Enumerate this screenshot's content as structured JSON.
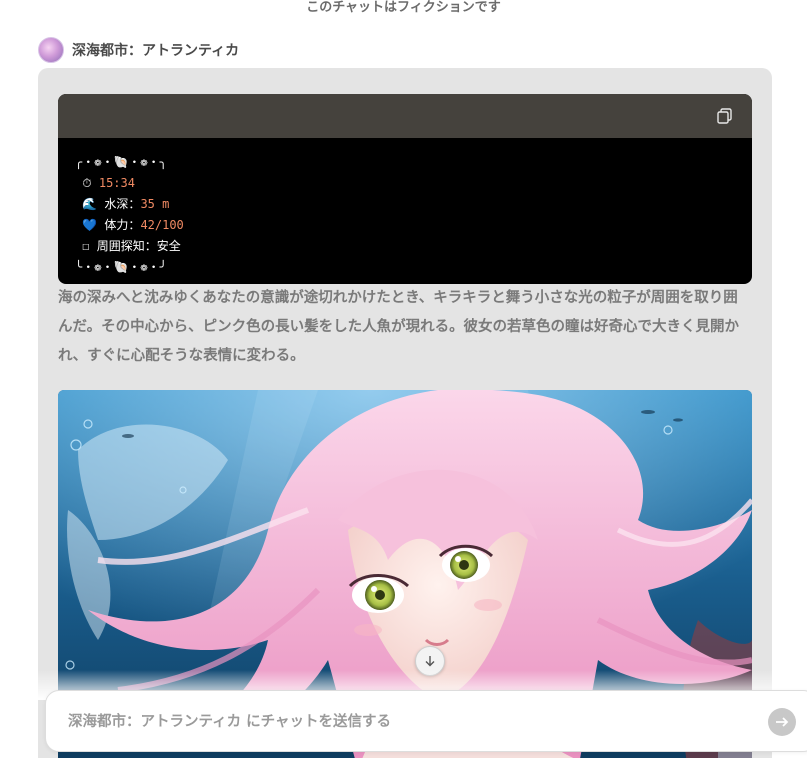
{
  "header": {
    "fiction_notice": "このチャットはフィクションです"
  },
  "message": {
    "sender_name": "深海都市：アトランティカ",
    "code_block": {
      "top_border": "╭・❁・🐚・❁・╮",
      "bottom_border": "╰・❁・🐚・❁・╯",
      "rows": [
        {
          "icon": "⏱",
          "label": "",
          "value": "15:34"
        },
        {
          "icon": "🌊",
          "label": "水深：",
          "value": "35 m"
        },
        {
          "icon": "💙",
          "label": "体力：",
          "value": "42/100"
        },
        {
          "icon": "☐",
          "label": "周囲探知：",
          "value": "安全"
        }
      ]
    },
    "narration": "海の深みへと沈みゆくあなたの意識が途切れかけたとき、キラキラと舞う小さな光の粒子が周囲を取り囲んだ。その中心から、ピンク色の長い髪をした人魚が現れる。彼女の若草色の瞳は好奇心で大きく見開かれ、すぐに心配そうな表情に変わる。"
  },
  "composer": {
    "placeholder": "深海都市：アトランティカ にチャットを送信する"
  },
  "icons": {
    "copy": "copy-icon",
    "scroll": "arrow-down-icon",
    "send": "arrow-right-icon"
  },
  "colors": {
    "bubble": "#e4e4e4",
    "code_header": "#45423d",
    "code_bg": "#000000",
    "number_accent": "#f08a63",
    "narration_text": "#7a7a7a",
    "hair_pink": "#f4b7d4",
    "eye_green": "#b9cf5a"
  }
}
